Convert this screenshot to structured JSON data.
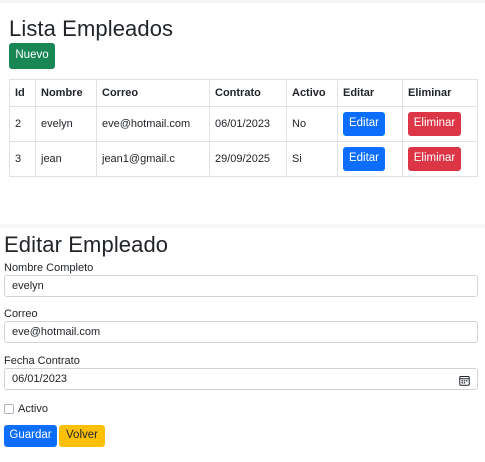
{
  "list": {
    "title": "Lista Empleados",
    "new_button": "Nuevo",
    "columns": [
      "Id",
      "Nombre",
      "Correo",
      "Contrato",
      "Activo",
      "Editar",
      "Eliminar"
    ],
    "rows": [
      {
        "id": "2",
        "nombre": "evelyn",
        "correo": "eve@hotmail.com",
        "contrato": "06/01/2023",
        "activo": "No",
        "edit_label": "Editar",
        "delete_label": "Eliminar"
      },
      {
        "id": "3",
        "nombre": "jean",
        "correo": "jean1@gmail.c",
        "contrato": "29/09/2025",
        "activo": "Si",
        "edit_label": "Editar",
        "delete_label": "Eliminar"
      }
    ]
  },
  "edit_form": {
    "title": "Editar Empleado",
    "name_label": "Nombre Completo",
    "name_value": "evelyn",
    "email_label": "Correo",
    "email_value": "eve@hotmail.com",
    "date_label": "Fecha Contrato",
    "date_value": "06/01/2023",
    "date_icon": "calendar-icon",
    "active_label": "Activo",
    "active_checked": false,
    "save_button": "Guardar",
    "back_button": "Volver"
  },
  "colors": {
    "success": "#198754",
    "primary": "#0d6efd",
    "danger": "#dc3545",
    "warning": "#ffc107"
  }
}
